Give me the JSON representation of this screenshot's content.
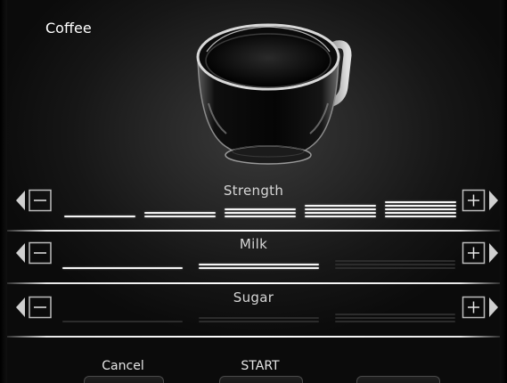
{
  "title": "Coffee",
  "params": [
    {
      "label": "Strength",
      "level": 5,
      "max": 5
    },
    {
      "label": "Milk",
      "level": 2,
      "max": 3
    },
    {
      "label": "Sugar",
      "level": 0,
      "max": 3
    }
  ],
  "buttons": {
    "cancel": "Cancel",
    "start": "START",
    "third": ""
  },
  "icons": {
    "decrease": "minus-icon",
    "increase": "plus-icon",
    "left": "arrow-left-icon",
    "right": "arrow-right-icon",
    "cup": "coffee-cup-icon"
  },
  "colors": {
    "background": "#1c1c1c",
    "active_level": "#f4f4f4",
    "inactive_level": "#2c2c2c",
    "text": "#ffffff"
  }
}
